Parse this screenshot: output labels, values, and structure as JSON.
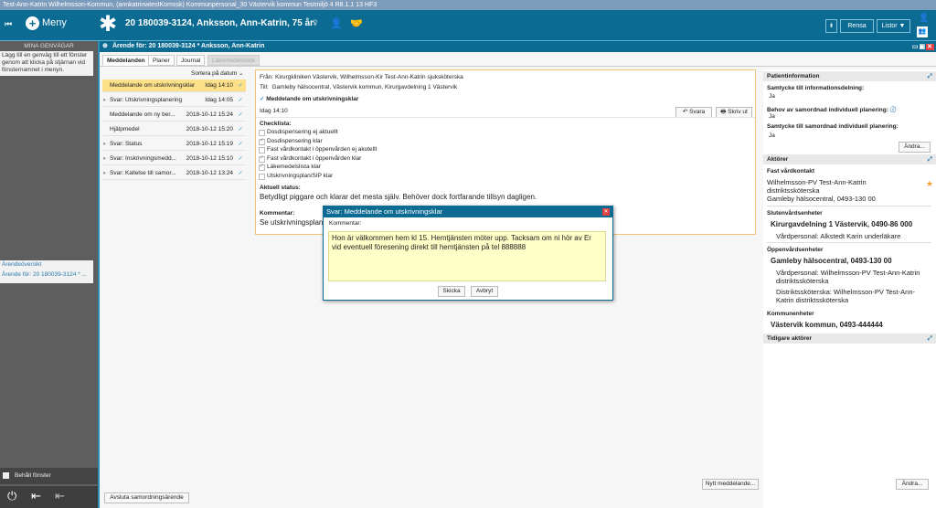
{
  "titlebar": {
    "text": "Test-Ann-Katrin  Wilhelmsson-Kommun, (annkatrinwtestKomssk) Kommunpersonal_30 Västervik kommun Testmiljö 4 R8.1.1 13 HF3"
  },
  "header": {
    "menu": "Meny",
    "patient": "20 180039-3124,  Anksson, Ann-Katrin,  75 år",
    "rensa": "Rensa",
    "listor": "Listor ▼"
  },
  "sidebar": {
    "title": "MINA GENVÄGAR",
    "hint": "Lägg till en genväg till ett fönster genom att klicka på stjärnan vid fönsternamnet i menyn.",
    "shortcuts": [
      "Ärendeöversikt",
      "Ärende för: 20 180039-3124 * ..."
    ],
    "keep_window": "Behåll fönster"
  },
  "window": {
    "title": "Ärende för: 20 180039-3124 * Anksson, Ann-Katrin",
    "tabs": [
      "Meddelanden",
      "Planer",
      "Journal",
      "Läkemedelslista"
    ],
    "sort": "Sortera på datum ⌄",
    "messages": [
      {
        "title": "Meddelande om utskrivningsklar",
        "date": "Idag 14:10",
        "expand": false,
        "selected": true
      },
      {
        "title": "Svar: Utskrivningsplanering",
        "date": "Idag 14:05",
        "expand": true
      },
      {
        "title": "Meddelande om ny ber...",
        "date": "2018-10-12 15:24",
        "expand": false
      },
      {
        "title": "Hjälpmedel",
        "date": "2018-10-12 15:20",
        "expand": false
      },
      {
        "title": "Svar: Status",
        "date": "2018-10-12 15:19",
        "expand": true
      },
      {
        "title": "Svar: Inskrivningsmedd...",
        "date": "2018-10-12 15:10",
        "expand": true
      },
      {
        "title": "Svar: Kallelse till samor...",
        "date": "2018-10-12 13:24",
        "expand": true
      }
    ],
    "detail": {
      "from_label": "Från:",
      "from": "Kirurgkliniken Västervik, Wilhelmsson-Kir Test-Ann-Katrin sjuksköterska",
      "to_label": "Till:",
      "to": "Gamleby hälsocentral, Västervik kommun, Kirurgavdelning 1 Västervik",
      "subject": "Meddelande om utskrivningsklar",
      "time": "Idag 14:10",
      "reply": "Svara",
      "print": "Skriv ut",
      "checklist_label": "Checklista:",
      "checklist": [
        {
          "label": "Dosdispensering ej aktuellt",
          "checked": false
        },
        {
          "label": "Dosdispensering klar",
          "checked": true
        },
        {
          "label": "Fast vårdkontakt i öppenvården ej akutellt",
          "checked": false
        },
        {
          "label": "Fast vårdkontakt i öppenvården klar",
          "checked": true
        },
        {
          "label": "Läkemedelslista klar",
          "checked": true
        },
        {
          "label": "Utskrivningsplan/SIP klar",
          "checked": false
        }
      ],
      "status_label": "Aktuell status:",
      "status": "Betydligt piggare och klarar det mesta själv. Behöver dock fortfarande tillsyn dagligen.",
      "comment_label": "Kommentar:",
      "comment": "Se utskrivningsplanen"
    },
    "new_message": "Nytt meddelande...",
    "close_case": "Avsluta samordningsärende"
  },
  "right": {
    "patient_info": "Patientinformation",
    "consent_label": "Samtycke till informationsdelning:",
    "consent": "Ja",
    "need_label": "Behov av samordnad individuell planering:",
    "need": "Ja",
    "consent2_label": "Samtycke till samordnad individuell planering:",
    "consent2": "Ja",
    "change": "Ändra...",
    "actors": "Aktörer",
    "fixed_contact": "Fast vårdkontakt",
    "fixed_name": "Wilhelmsson-PV Test-Ann-Katrin distriktssköterska",
    "fixed_unit": "Gamleby hälsocentral, 0493-130 00",
    "inpatient": "Slutenvårdsenheter",
    "inpatient_unit": "Kirurgavdelning 1 Västervik, 0490-86 000",
    "inpatient_staff": "Vårdpersonal: Alkstedt Karin underläkare",
    "outpatient": "Öppenvårdsenheter",
    "outpatient_unit": "Gamleby hälsocentral, 0493-130 00",
    "outpatient_staff": "Vårdpersonal: Wilhelmsson-PV Test-Ann-Katrin distriktssköterska",
    "outpatient_nurse": "Distriktssköterska: Wilhelmsson-PV Test-Ann-Katrin distriktssköterska",
    "municipal": "Kommunenheter",
    "municipal_unit": "Västervik kommun, 0493-444444",
    "previous": "Tidigare aktörer",
    "change2": "Ändra..."
  },
  "dialog": {
    "title": "Svar: Meddelande om utskrivningsklar",
    "label": "Kommentar:",
    "text": "Hon är välkommen hem kl 15. Hemtjänsten möter upp. Tacksam om ni hör av Er vid eventuell föresening direkt till hemtjänsten på tel 888888",
    "send": "Skicka",
    "cancel": "Avbryt"
  },
  "colors": {
    "header": "#0b6b92",
    "selected": "#fde08a",
    "sidebar": "#5e5e5e"
  }
}
